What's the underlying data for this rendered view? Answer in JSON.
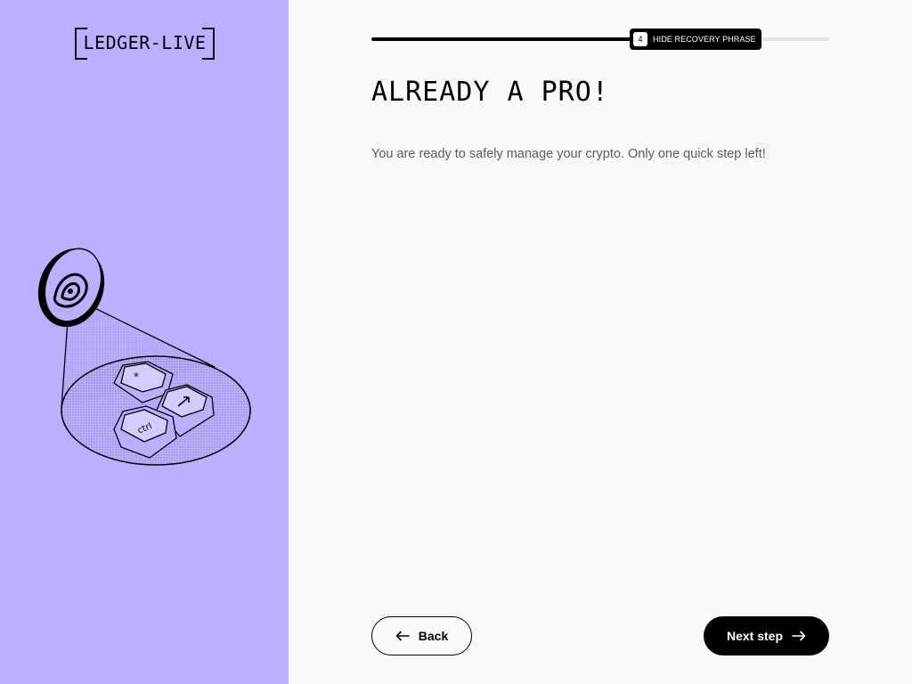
{
  "app": {
    "logo_text": "LEDGER-LIVE"
  },
  "stepper": {
    "progress_fraction": 0.57,
    "step_number": "4",
    "step_label": "HIDE RECOVERY PHRASE"
  },
  "main": {
    "title": "ALREADY A PRO!",
    "subtitle": "You are ready to safely manage your crypto. Only one quick step left!"
  },
  "footer": {
    "back_label": "Back",
    "next_label": "Next step"
  },
  "illustration": {
    "key_labels": [
      "*",
      "ctrl"
    ],
    "icons": [
      "eye-icon",
      "arrow-key-icon"
    ]
  },
  "colors": {
    "left_panel_bg": "#bbb0ff",
    "right_panel_bg": "#f9f9f9",
    "accent": "#000000"
  }
}
